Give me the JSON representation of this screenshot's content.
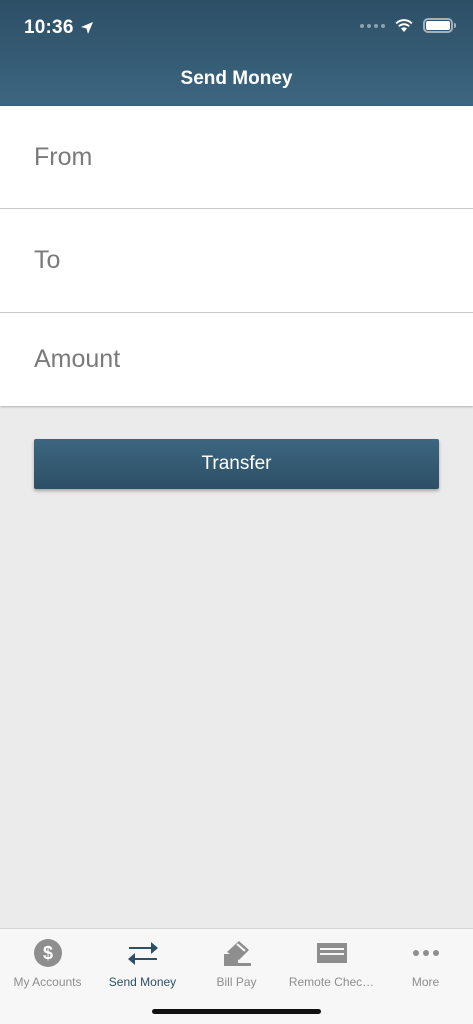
{
  "status_bar": {
    "time": "10:36"
  },
  "header": {
    "title": "Send Money"
  },
  "form": {
    "from_placeholder": "From",
    "to_placeholder": "To",
    "amount_placeholder": "Amount"
  },
  "actions": {
    "transfer_label": "Transfer"
  },
  "tabbar": {
    "items": [
      {
        "label": "My Accounts",
        "icon": "dollar-circle-icon"
      },
      {
        "label": "Send Money",
        "icon": "transfer-arrows-icon",
        "active": true
      },
      {
        "label": "Bill Pay",
        "icon": "bill-pay-icon"
      },
      {
        "label": "Remote Chec…",
        "icon": "check-deposit-icon"
      },
      {
        "label": "More",
        "icon": "more-dots-icon"
      }
    ]
  },
  "colors": {
    "brand": "#2c4f66",
    "brand_light": "#3d6680",
    "background": "#ebebeb",
    "tab_inactive": "#8e8e8e"
  }
}
